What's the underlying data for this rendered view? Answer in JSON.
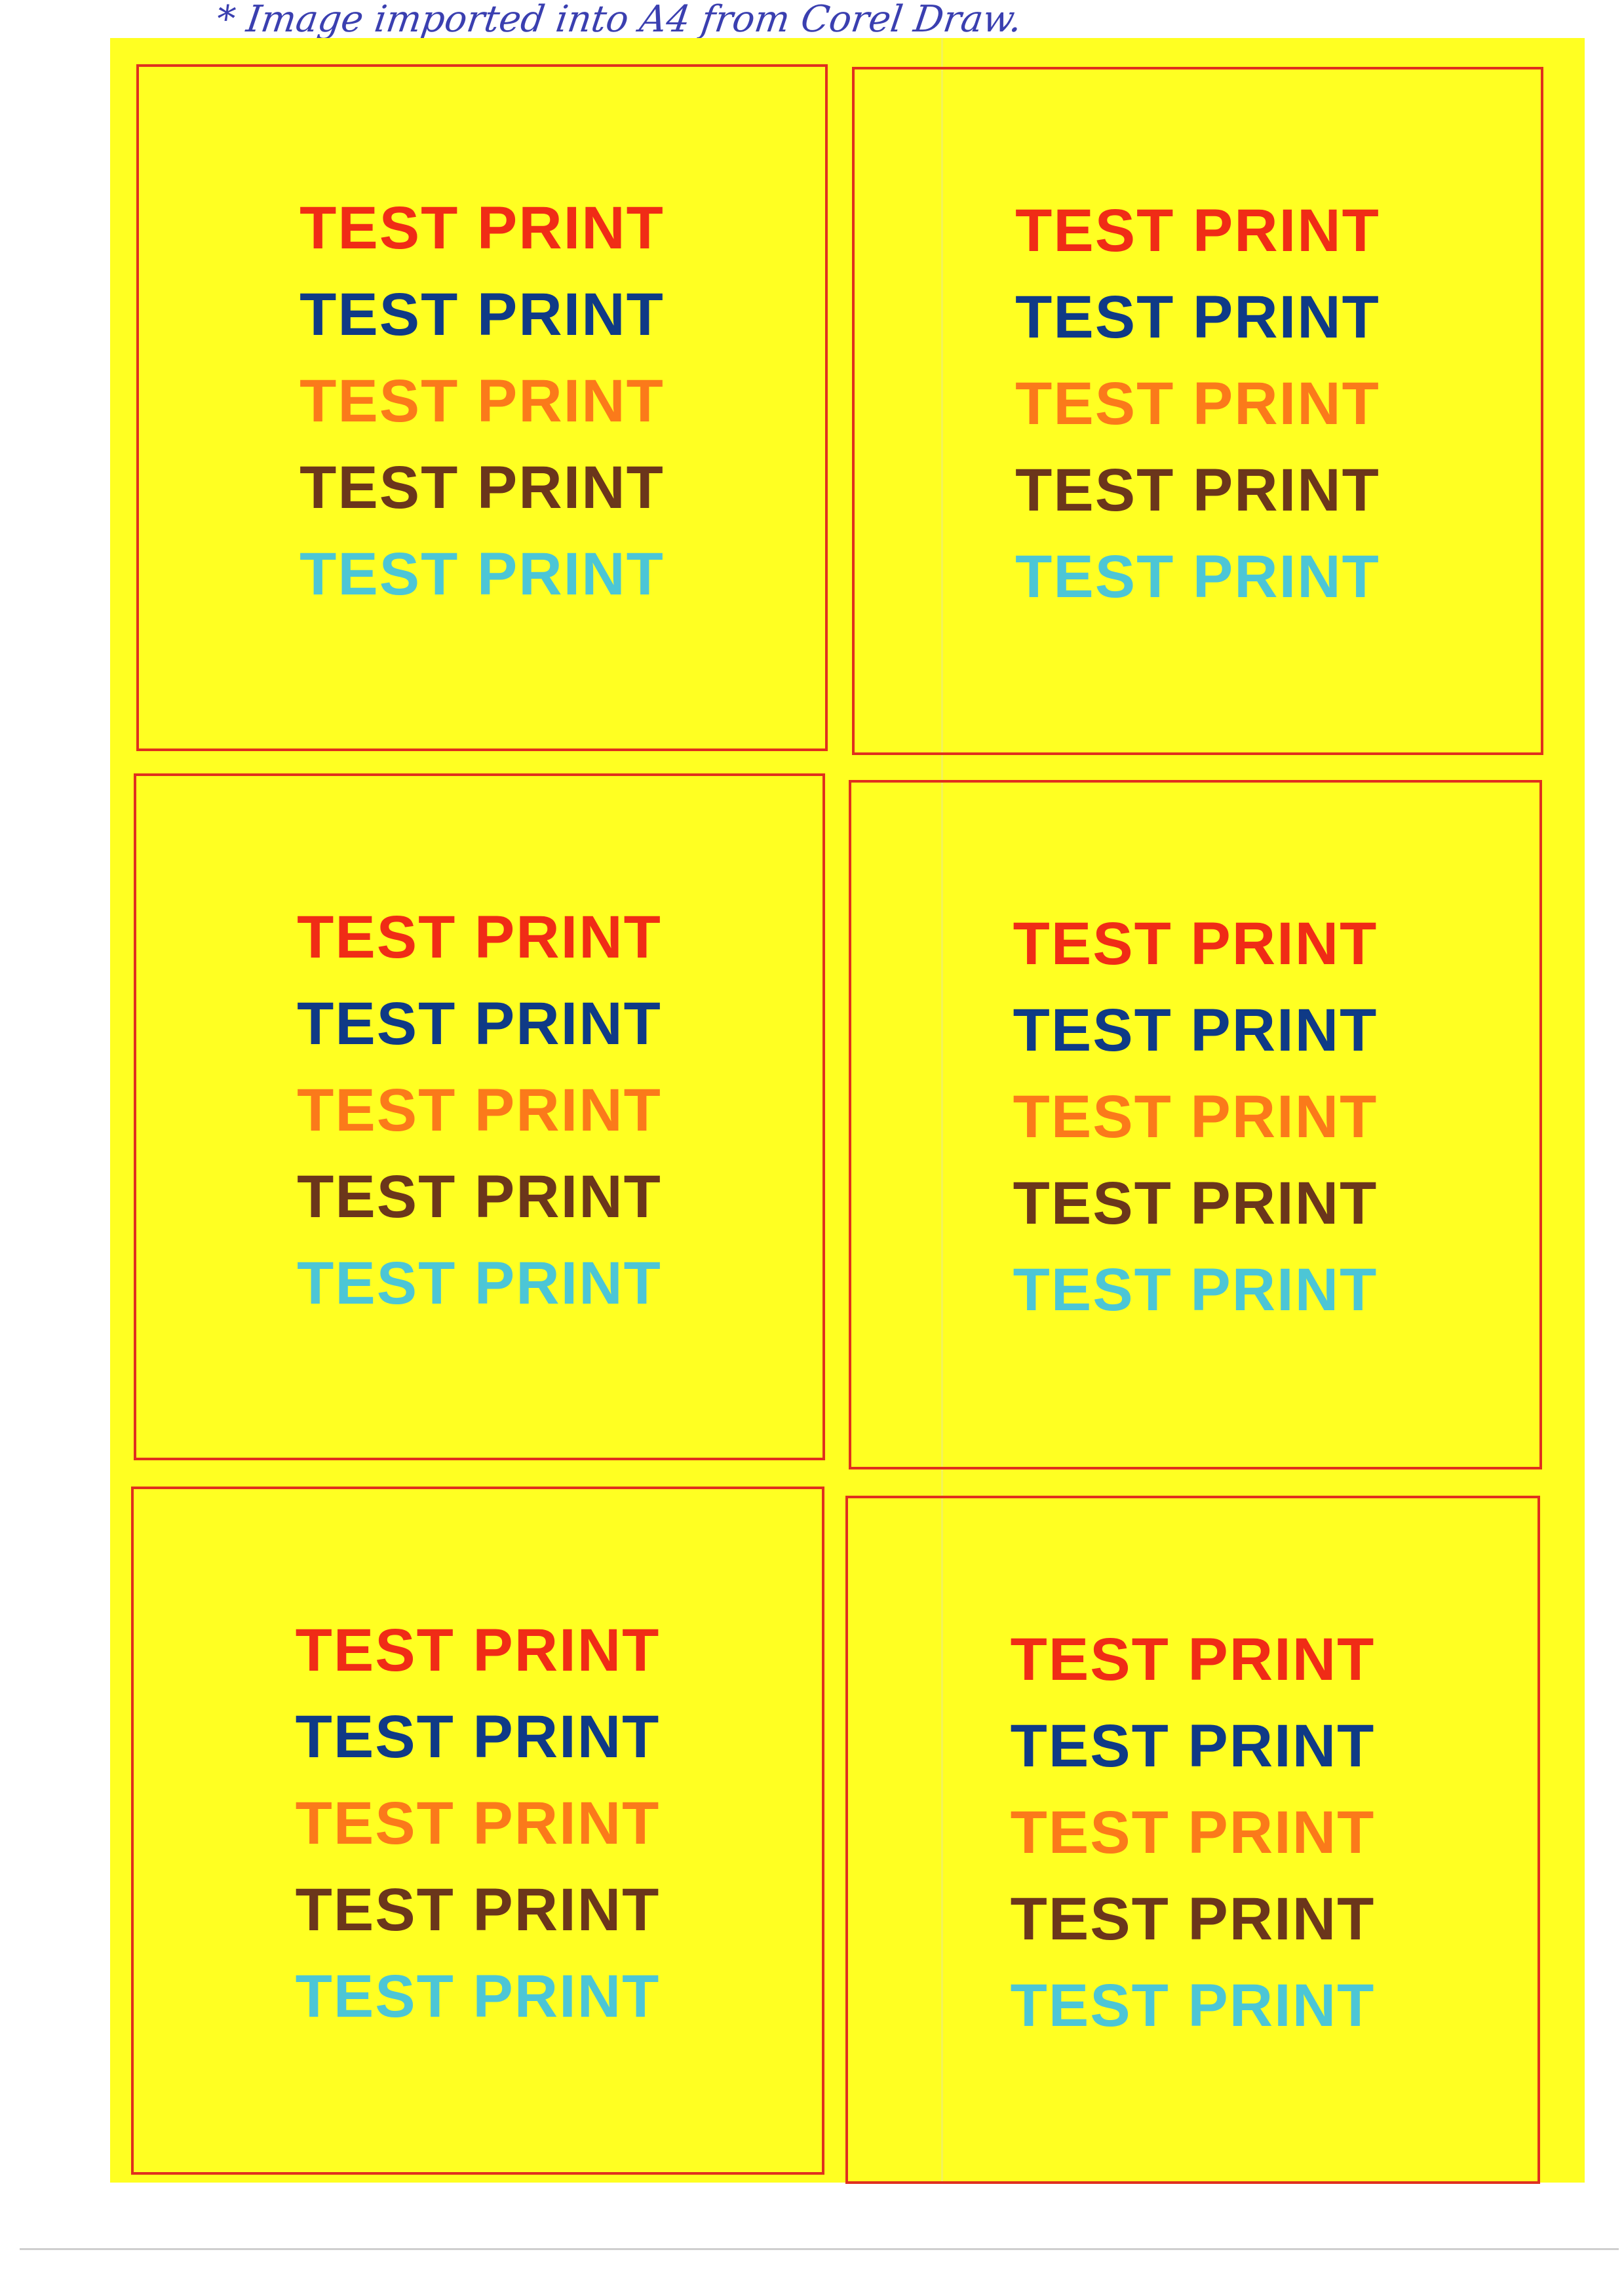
{
  "annotation": "* Image imported into A4 from Corel Draw.",
  "labels": [
    {
      "lines": [
        "TEST PRINT",
        "TEST PRINT",
        "TEST PRINT",
        "TEST PRINT",
        "TEST PRINT"
      ]
    },
    {
      "lines": [
        "TEST PRINT",
        "TEST PRINT",
        "TEST PRINT",
        "TEST PRINT",
        "TEST PRINT"
      ]
    },
    {
      "lines": [
        "TEST PRINT",
        "TEST PRINT",
        "TEST PRINT",
        "TEST PRINT",
        "TEST PRINT"
      ]
    },
    {
      "lines": [
        "TEST PRINT",
        "TEST PRINT",
        "TEST PRINT",
        "TEST PRINT",
        "TEST PRINT"
      ]
    },
    {
      "lines": [
        "TEST PRINT",
        "TEST PRINT",
        "TEST PRINT",
        "TEST PRINT",
        "TEST PRINT"
      ]
    },
    {
      "lines": [
        "TEST PRINT",
        "TEST PRINT",
        "TEST PRINT",
        "TEST PRINT",
        "TEST PRINT"
      ]
    }
  ],
  "colors": {
    "sheet": "#ffff22",
    "border": "#e0301e",
    "line_colors": [
      "#f02c16",
      "#0f3a86",
      "#fb7a1a",
      "#6b361b",
      "#4cc6d6"
    ]
  }
}
